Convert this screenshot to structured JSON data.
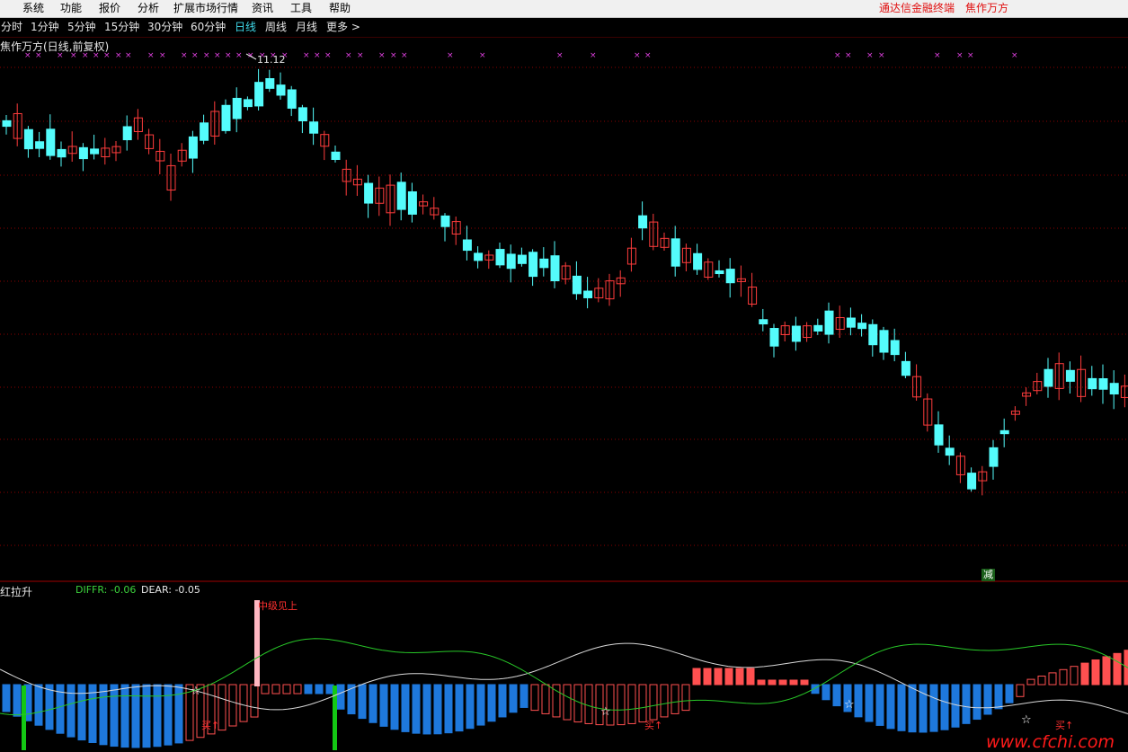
{
  "menu": {
    "items": [
      "系统",
      "功能",
      "报价",
      "分析",
      "扩展市场行情",
      "资讯",
      "工具",
      "帮助"
    ],
    "right_items": [
      "通达信金融终端",
      "焦作万方"
    ]
  },
  "periods": {
    "items": [
      "分时",
      "1分钟",
      "5分钟",
      "15分钟",
      "30分钟",
      "60分钟",
      "日线",
      "周线",
      "月线",
      "更多 >"
    ],
    "active": "日线"
  },
  "upper_panel": {
    "title": "焦作万方(日线,前复权)",
    "max_label": "11.12",
    "signal_box": "减"
  },
  "lower_panel": {
    "title": "红拉升",
    "diffr": "DIFFR: -0.06",
    "dear": "DEAR: -0.05",
    "signal_text": "中级见上",
    "buy_label": "买↑"
  },
  "watermark": "www.cfchi.com",
  "colors": {
    "up_candle": "#ff3c3c",
    "down_candle": "#54fcfc",
    "grid": "#8b0000",
    "macd_pos": "#ff5050",
    "macd_neg": "#1e78dc",
    "line_white": "#d8d8d8",
    "line_green": "#28c828",
    "marker": "#e040e0"
  }
}
